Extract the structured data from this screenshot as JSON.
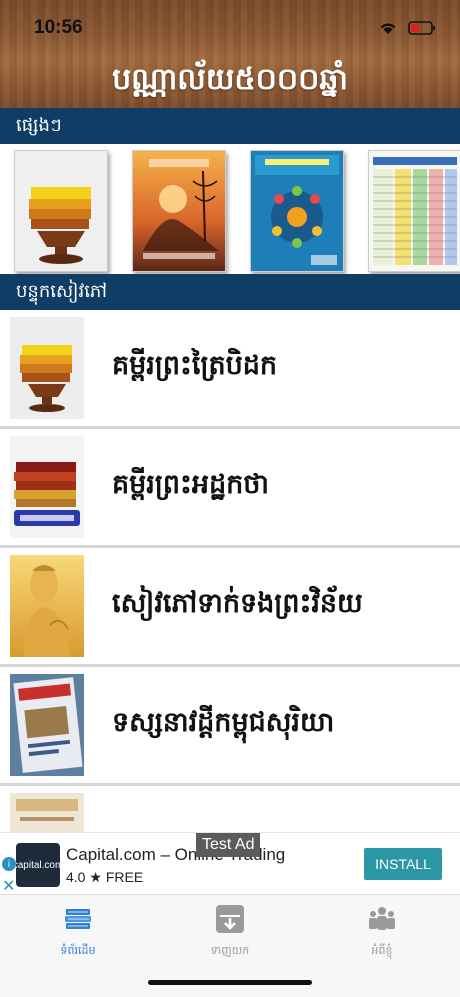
{
  "status": {
    "time": "10:56"
  },
  "header": {
    "title": "បណ្ណាល័យ៥០០០ឆ្នាំ"
  },
  "sections": {
    "misc_label": "ផ្សេងៗ",
    "books_label": "បន្ទុកសៀវភៅ"
  },
  "featured": [
    {
      "name": "featured-book-1",
      "icon": "stacked-books-icon"
    },
    {
      "name": "featured-book-2",
      "icon": "sunset-buddha-cover"
    },
    {
      "name": "featured-book-3",
      "icon": "blue-zodiac-cover"
    },
    {
      "name": "featured-book-4",
      "icon": "calendar-table-cover"
    }
  ],
  "list": [
    {
      "title": "គម្ពីរព្រះត្រៃបិដក",
      "icon": "stacked-books-icon"
    },
    {
      "title": "គម្ពីរព្រះអដ្ឋកថា",
      "icon": "atthakatha-books-icon"
    },
    {
      "title": "សៀវភៅទាក់ទងព្រះវិន័យ",
      "icon": "buddha-statue-icon"
    },
    {
      "title": "ទស្សនាវដ្ដីកម្ពុជសុរិយា",
      "icon": "magazine-icon"
    }
  ],
  "ad": {
    "title": "Capital.com – Online Trading",
    "rating": "4.0",
    "price": "FREE",
    "install_label": "INSTALL",
    "test_label": "Test Ad",
    "logo_text": "capital.com"
  },
  "tabs": [
    {
      "label": "ទំព័រដើម",
      "icon": "books-icon",
      "active": true
    },
    {
      "label": "ទាញយក",
      "icon": "download-icon",
      "active": false
    },
    {
      "label": "អំពីខ្ញុំ",
      "icon": "people-icon",
      "active": false
    }
  ],
  "colors": {
    "section_bar": "#0f3d66",
    "tab_active": "#2f7fd6",
    "tab_inactive": "#9a9a9a",
    "install": "#2a96a6"
  }
}
